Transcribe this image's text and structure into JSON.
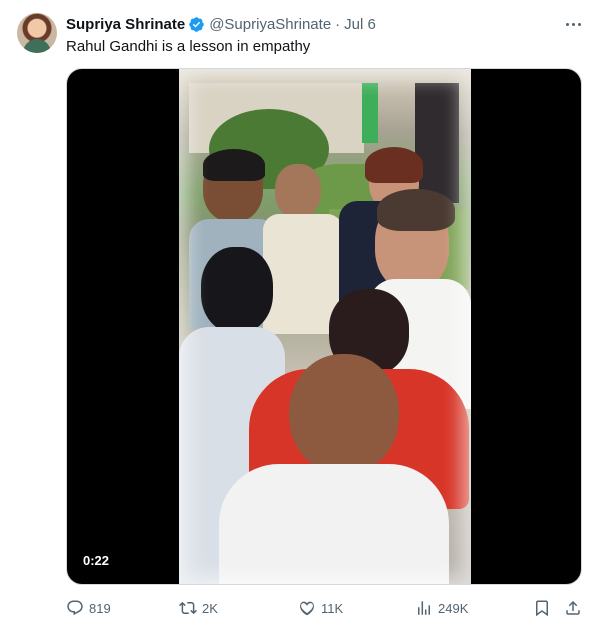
{
  "author": {
    "name": "Supriya Shrinate",
    "handle": "@SupriyaShrinate",
    "separator": "·",
    "date": "Jul 6"
  },
  "tweet": {
    "text": "Rahul Gandhi is a lesson in empathy"
  },
  "media": {
    "type": "video",
    "duration": "0:22"
  },
  "actions": {
    "replies": "819",
    "reposts": "2K",
    "likes": "11K",
    "views": "249K"
  },
  "colors": {
    "text_primary": "#0f1419",
    "text_secondary": "#536471",
    "verified_blue": "#1d9bf0",
    "border": "#cfd9de"
  },
  "icons": [
    "more-icon",
    "verified-icon",
    "reply-icon",
    "repost-icon",
    "like-icon",
    "views-icon",
    "bookmark-icon",
    "share-icon"
  ]
}
